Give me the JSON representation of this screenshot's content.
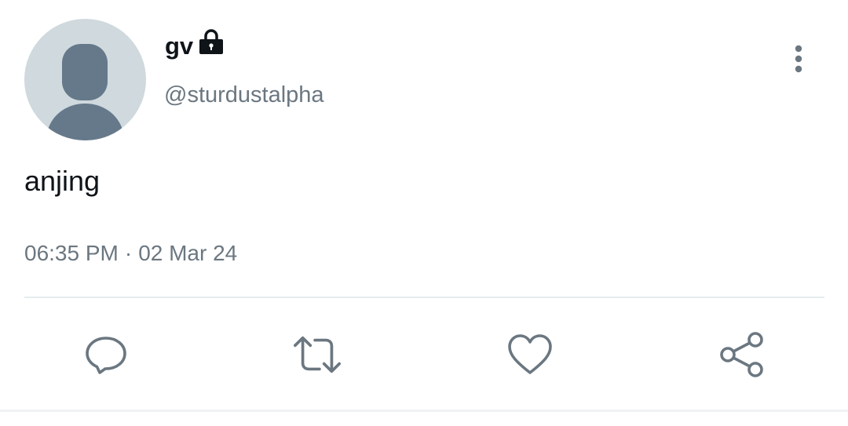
{
  "user": {
    "display_name": "gv",
    "handle": "@sturdustalpha",
    "protected_icon": "lock-icon",
    "avatar_icon": "default-avatar-icon"
  },
  "tweet": {
    "text": "anjing",
    "time": "06:35 PM",
    "separator": "·",
    "date": "02 Mar 24"
  },
  "actions": [
    {
      "name": "reply",
      "icon": "reply-icon"
    },
    {
      "name": "retweet",
      "icon": "retweet-icon"
    },
    {
      "name": "like",
      "icon": "heart-icon"
    },
    {
      "name": "share",
      "icon": "share-icon"
    }
  ],
  "colors": {
    "text_primary": "#0f1419",
    "text_secondary": "#6b7780",
    "icon": "#6b7780",
    "avatar_bg": "#cfd9de",
    "avatar_fg": "#66798a",
    "divider": "#e6ecf0"
  }
}
